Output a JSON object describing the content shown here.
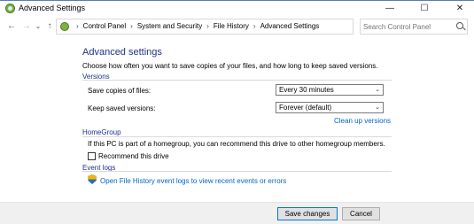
{
  "window": {
    "title": "Advanced Settings",
    "minimize_glyph": "—",
    "maximize_glyph": "☐",
    "close_glyph": "✕"
  },
  "nav": {
    "back_glyph": "←",
    "forward_glyph": "→",
    "recent_glyph": "⌄",
    "up_glyph": "↑"
  },
  "address": {
    "breadcrumbs": [
      "Control Panel",
      "System and Security",
      "File History",
      "Advanced Settings"
    ],
    "separator": "›",
    "dropdown_glyph": "⌄",
    "refresh_glyph": "↻"
  },
  "search": {
    "placeholder": "Search Control Panel"
  },
  "main": {
    "heading": "Advanced settings",
    "description": "Choose how often you want to save copies of your files, and how long to keep saved versions.",
    "versions": {
      "title": "Versions",
      "save_copies_label": "Save copies of files:",
      "save_copies_value": "Every 30 minutes",
      "keep_versions_label": "Keep saved versions:",
      "keep_versions_value": "Forever (default)",
      "cleanup_link": "Clean up versions"
    },
    "homegroup": {
      "title": "HomeGroup",
      "description": "If this PC is part of a homegroup, you can recommend this drive to other homegroup members.",
      "recommend_label": "Recommend this drive",
      "recommend_checked": false
    },
    "event_logs": {
      "title": "Event logs",
      "link": "Open File History event logs to view recent events or errors"
    }
  },
  "footer": {
    "save_label": "Save changes",
    "cancel_label": "Cancel"
  },
  "colors": {
    "accent": "#1e3287",
    "link": "#0066cc"
  }
}
